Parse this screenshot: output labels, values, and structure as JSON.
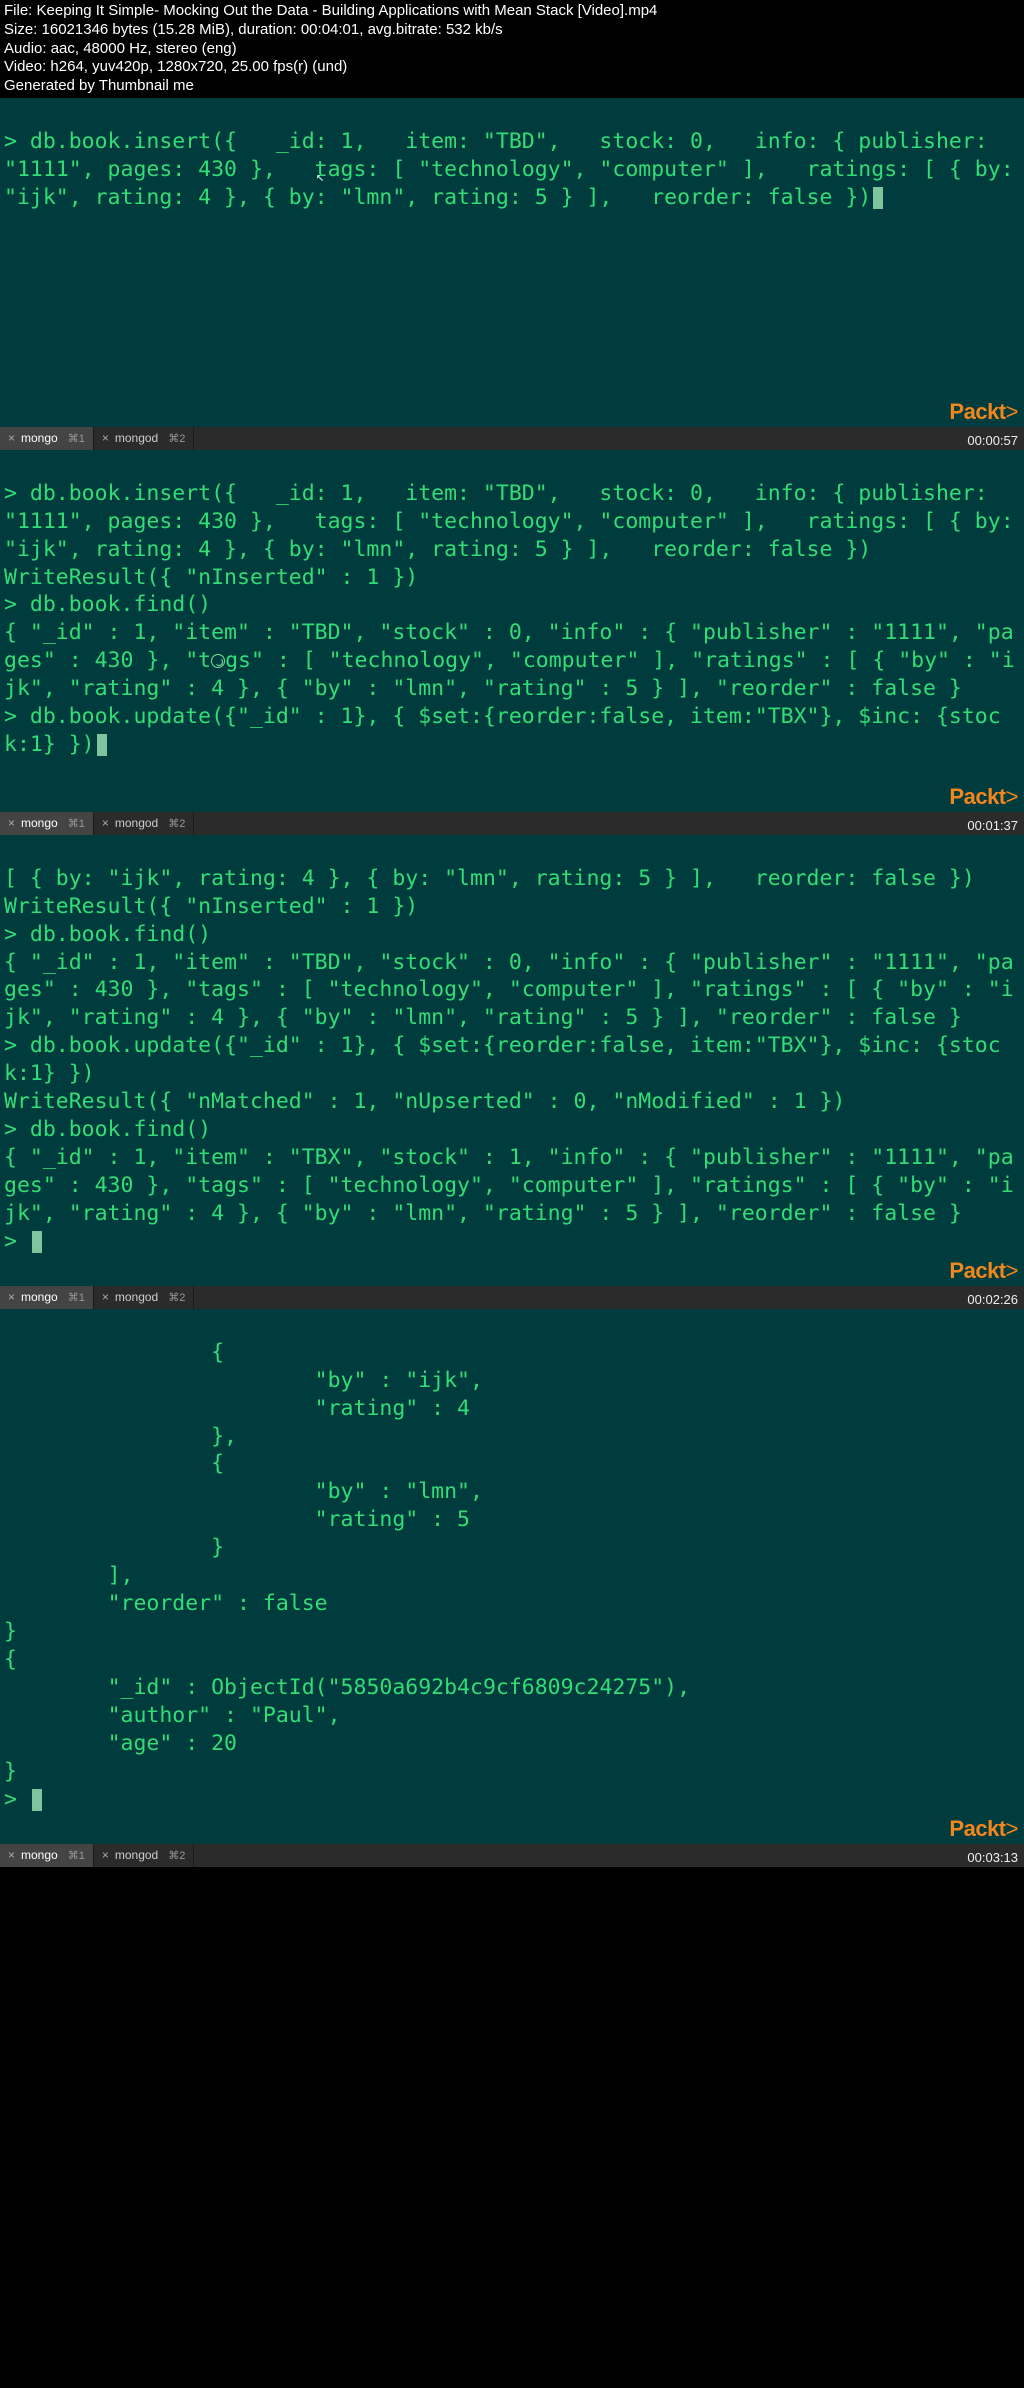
{
  "header": {
    "file": "File: Keeping It Simple- Mocking Out the Data - Building Applications with Mean Stack [Video].mp4",
    "size": "Size: 16021346 bytes (15.28 MiB), duration: 00:04:01, avg.bitrate: 532 kb/s",
    "audio": "Audio: aac, 48000 Hz, stereo (eng)",
    "video": "Video: h264, yuv420p, 1280x720, 25.00 fps(r) (und)",
    "generated": "Generated by Thumbnail me"
  },
  "brand": "Packt",
  "tabs": {
    "t1": {
      "label": "mongo",
      "kb": "⌘1"
    },
    "t2": {
      "label": "mongod",
      "kb": "⌘2"
    }
  },
  "timestamps": {
    "s1": "00:00:57",
    "s2": "00:01:37",
    "s3": "00:02:26",
    "s4": "00:03:13"
  },
  "shell1": {
    "l1": "> db.book.insert({   _id: 1,   item: \"TBD\",   stock: 0,   info: { publisher: \"1111\", pages: 430 },   tags: [ \"technology\", \"computer\" ],   ratings: [ { by: \"ijk\", rating: 4 }, { by: \"lmn\", rating: 5 } ],   reorder: false })"
  },
  "shell2": {
    "l1": "> db.book.insert({   _id: 1,   item: \"TBD\",   stock: 0,   info: { publisher: \"1111\", pages: 430 },   tags: [ \"technology\", \"computer\" ],   ratings: [ { by: \"ijk\", rating: 4 }, { by: \"lmn\", rating: 5 } ],   reorder: false })",
    "l2": "WriteResult({ \"nInserted\" : 1 })",
    "l3": "> db.book.find()",
    "l4a": "{ \"_id\" : 1, \"item\" : \"TBD\", \"stock\" : 0, \"info\" : { \"publisher\" : \"1111\", \"pages\" : 430 }, \"t",
    "l4b": "gs\" : [ \"technology\", \"computer\" ], \"ratings\" : [ { \"by\" : \"ijk\", \"rating\" : 4 }, { \"by\" : \"lmn\", \"rating\" : 5 } ], \"reorder\" : false }",
    "l5": "> db.book.update({\"_id\" : 1}, { $set:{reorder:false, item:\"TBX\"}, $inc: {stock:1} })"
  },
  "shell3": {
    "l0": "[ { by: \"ijk\", rating: 4 }, { by: \"lmn\", rating: 5 } ],   reorder: false })",
    "l1": "WriteResult({ \"nInserted\" : 1 })",
    "l2": "> db.book.find()",
    "l3": "{ \"_id\" : 1, \"item\" : \"TBD\", \"stock\" : 0, \"info\" : { \"publisher\" : \"1111\", \"pages\" : 430 }, \"tags\" : [ \"technology\", \"computer\" ], \"ratings\" : [ { \"by\" : \"ijk\", \"rating\" : 4 }, { \"by\" : \"lmn\", \"rating\" : 5 } ], \"reorder\" : false }",
    "l4": "> db.book.update({\"_id\" : 1}, { $set:{reorder:false, item:\"TBX\"}, $inc: {stock:1} })",
    "l5": "WriteResult({ \"nMatched\" : 1, \"nUpserted\" : 0, \"nModified\" : 1 })",
    "l6": "> db.book.find()",
    "l7": "{ \"_id\" : 1, \"item\" : \"TBX\", \"stock\" : 1, \"info\" : { \"publisher\" : \"1111\", \"pages\" : 430 }, \"tags\" : [ \"technology\", \"computer\" ], \"ratings\" : [ { \"by\" : \"ijk\", \"rating\" : 4 }, { \"by\" : \"lmn\", \"rating\" : 5 } ], \"reorder\" : false }",
    "l8": "> "
  },
  "shell4": {
    "l1": "                {",
    "l2": "                        \"by\" : \"ijk\",",
    "l3": "                        \"rating\" : 4",
    "l4": "                },",
    "l5": "                {",
    "l6": "                        \"by\" : \"lmn\",",
    "l7": "                        \"rating\" : 5",
    "l8": "                }",
    "l9": "        ],",
    "l10": "        \"reorder\" : false",
    "l11": "}",
    "l12": "{",
    "l13": "        \"_id\" : ObjectId(\"5850a692b4c9cf6809c24275\"),",
    "l14": "        \"author\" : \"Paul\",",
    "l15": "        \"age\" : 20",
    "l16": "}",
    "l17": "> "
  }
}
